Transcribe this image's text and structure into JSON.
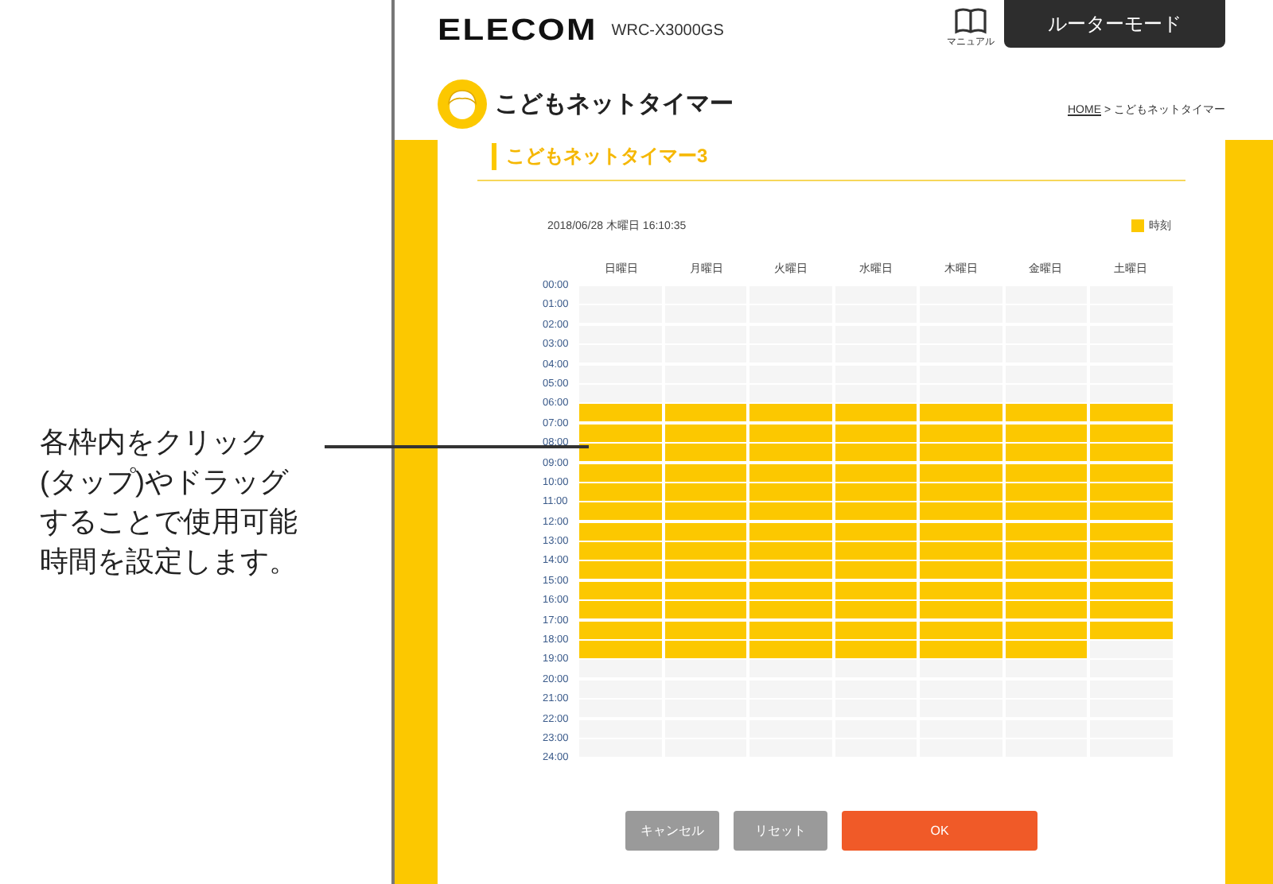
{
  "header": {
    "logo": "ELECOM",
    "model": "WRC-X3000GS",
    "manual_label": "マニュアル",
    "mode_button": "ルーターモード"
  },
  "page_title": "こどもネットタイマー",
  "breadcrumb": {
    "home": "HOME",
    "separator": ">",
    "current": "こどもネットタイマー"
  },
  "section_title": "こどもネットタイマー3",
  "timestamp": "2018/06/28 木曜日 16:10:35",
  "legend": "時刻",
  "times": [
    "00:00",
    "01:00",
    "02:00",
    "03:00",
    "04:00",
    "05:00",
    "06:00",
    "07:00",
    "08:00",
    "09:00",
    "10:00",
    "11:00",
    "12:00",
    "13:00",
    "14:00",
    "15:00",
    "16:00",
    "17:00",
    "18:00",
    "19:00",
    "20:00",
    "21:00",
    "22:00",
    "23:00",
    "24:00"
  ],
  "days": [
    {
      "label": "日曜日",
      "slots": [
        false,
        false,
        false,
        false,
        false,
        false,
        true,
        true,
        true,
        true,
        true,
        true,
        true,
        true,
        true,
        true,
        true,
        true,
        true,
        false,
        false,
        false,
        false,
        false
      ]
    },
    {
      "label": "月曜日",
      "slots": [
        false,
        false,
        false,
        false,
        false,
        false,
        true,
        true,
        true,
        true,
        true,
        true,
        true,
        true,
        true,
        true,
        true,
        true,
        true,
        false,
        false,
        false,
        false,
        false
      ]
    },
    {
      "label": "火曜日",
      "slots": [
        false,
        false,
        false,
        false,
        false,
        false,
        true,
        true,
        true,
        true,
        true,
        true,
        true,
        true,
        true,
        true,
        true,
        true,
        true,
        false,
        false,
        false,
        false,
        false
      ]
    },
    {
      "label": "水曜日",
      "slots": [
        false,
        false,
        false,
        false,
        false,
        false,
        true,
        true,
        true,
        true,
        true,
        true,
        true,
        true,
        true,
        true,
        true,
        true,
        true,
        false,
        false,
        false,
        false,
        false
      ]
    },
    {
      "label": "木曜日",
      "slots": [
        false,
        false,
        false,
        false,
        false,
        false,
        true,
        true,
        true,
        true,
        true,
        true,
        true,
        true,
        true,
        true,
        true,
        true,
        true,
        false,
        false,
        false,
        false,
        false
      ]
    },
    {
      "label": "金曜日",
      "slots": [
        false,
        false,
        false,
        false,
        false,
        false,
        true,
        true,
        true,
        true,
        true,
        true,
        true,
        true,
        true,
        true,
        true,
        true,
        true,
        false,
        false,
        false,
        false,
        false
      ]
    },
    {
      "label": "土曜日",
      "slots": [
        false,
        false,
        false,
        false,
        false,
        false,
        true,
        true,
        true,
        true,
        true,
        true,
        true,
        true,
        true,
        true,
        true,
        true,
        false,
        false,
        false,
        false,
        false,
        false
      ]
    }
  ],
  "buttons": [
    {
      "label": "キャンセル",
      "kind": "secondary"
    },
    {
      "label": "リセット",
      "kind": "secondary"
    },
    {
      "label": "OK",
      "kind": "primary"
    }
  ],
  "annotation_lines": [
    "各枠内をクリック",
    "(タップ)やドラッグ",
    "することで使用可能",
    "時間を設定します。"
  ]
}
